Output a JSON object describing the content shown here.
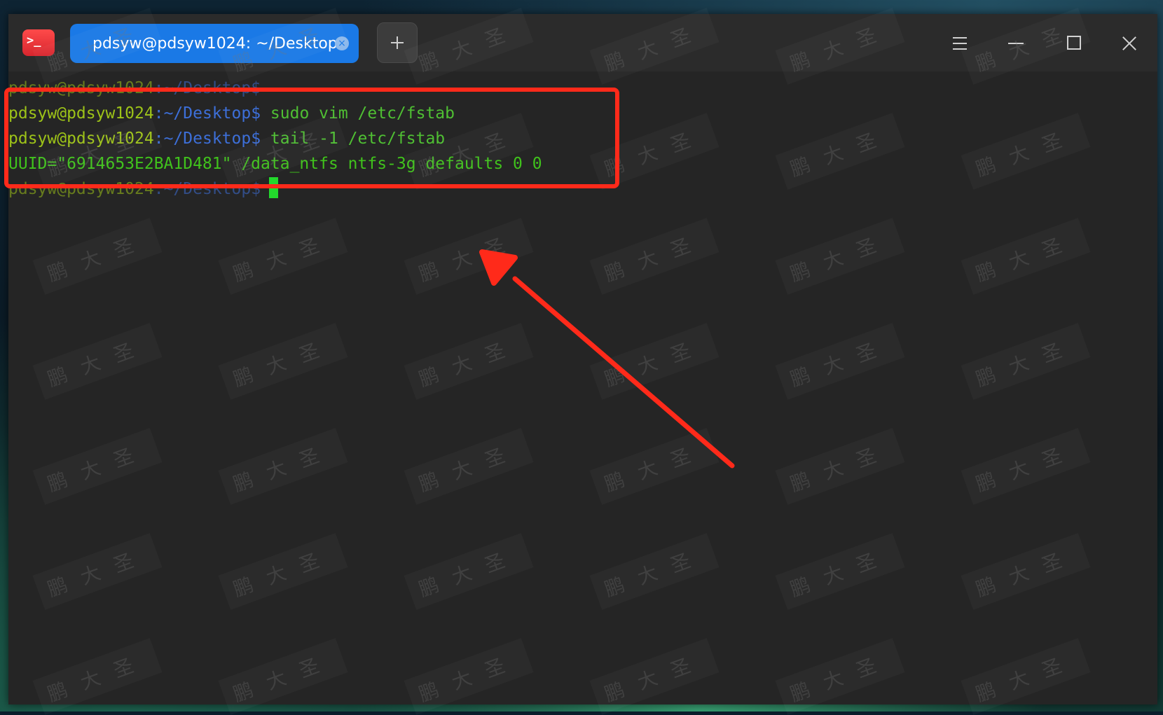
{
  "window": {
    "tab_title": "pdsyw@pdsyw1024: ~/Desktop",
    "tab_close_glyph": "×",
    "app_icon_glyph": ">_",
    "icons": [
      "terminal-app-icon",
      "tab-close-icon",
      "plus-icon",
      "menu-icon",
      "minimize-icon",
      "maximize-icon",
      "close-icon"
    ]
  },
  "terminal": {
    "lines": [
      {
        "user": "pdsyw@pdsyw1024",
        "sep": ":",
        "path": "~/Desktop",
        "dollar": "$",
        "cmd": ""
      },
      {
        "user": "pdsyw@pdsyw1024",
        "sep": ":",
        "path": "~/Desktop",
        "dollar": "$",
        "cmd": " sudo vim /etc/fstab"
      },
      {
        "user": "pdsyw@pdsyw1024",
        "sep": ":",
        "path": "~/Desktop",
        "dollar": "$",
        "cmd": " tail -1 /etc/fstab"
      },
      {
        "output": "UUID=\"6914653E2BA1D481\" /data_ntfs ntfs-3g defaults 0 0"
      },
      {
        "user": "pdsyw@pdsyw1024",
        "sep": ":",
        "path": "~/Desktop",
        "dollar": "$",
        "cmd": ""
      }
    ]
  },
  "watermark": {
    "text": "鹏大圣",
    "color": "#8a8a8a"
  },
  "colors": {
    "user": "#9dc318",
    "path": "#3d6fd8",
    "output": "#40c21c",
    "cursor": "#23d82c",
    "tab_active": "#1a79e6",
    "annotation": "#ff2a1a",
    "terminal_bg": "#252525"
  }
}
